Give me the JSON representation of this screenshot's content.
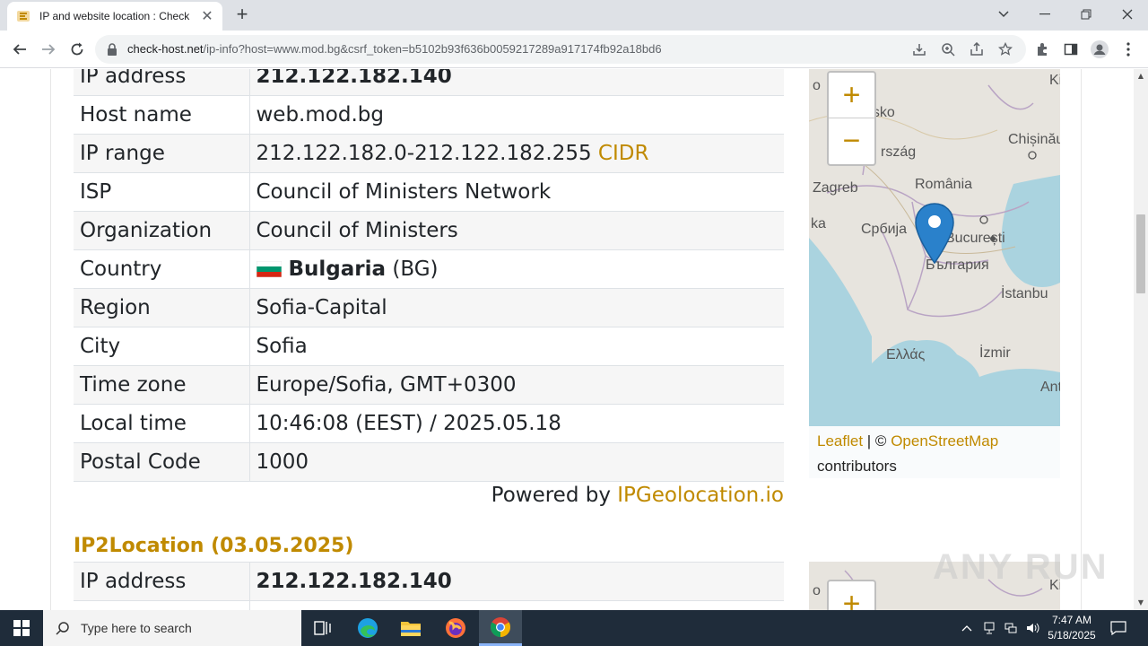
{
  "browser": {
    "tab_title": "IP and website location : Check h",
    "url_host": "check-host.net",
    "url_path": "/ip-info?host=www.mod.bg&csrf_token=b5102b93f636b0059217289a917174fb92a18bd6"
  },
  "info_table": {
    "rows": [
      {
        "label": "IP address",
        "value": "212.122.182.140"
      },
      {
        "label": "Host name",
        "value": "web.mod.bg"
      },
      {
        "label": "IP range",
        "value": "212.122.182.0-212.122.182.255",
        "link": "CIDR"
      },
      {
        "label": "ISP",
        "value": "Council of Ministers Network"
      },
      {
        "label": "Organization",
        "value": "Council of Ministers"
      },
      {
        "label": "Country",
        "value": "Bulgaria",
        "suffix": "(BG)"
      },
      {
        "label": "Region",
        "value": "Sofia-Capital"
      },
      {
        "label": "City",
        "value": "Sofia"
      },
      {
        "label": "Time zone",
        "value": "Europe/Sofia, GMT+0300"
      },
      {
        "label": "Local time",
        "value": "10:46:08 (EEST) / 2025.05.18"
      },
      {
        "label": "Postal Code",
        "value": "1000"
      }
    ]
  },
  "powered": {
    "prefix": "Powered by",
    "link": "IPGeolocation.io"
  },
  "section2": {
    "title": "IP2Location (03.05.2025)",
    "rows": [
      {
        "label": "IP address",
        "value": "212.122.182.140"
      }
    ]
  },
  "map": {
    "zoom_in": "+",
    "zoom_out": "−",
    "attribution_leaflet": "Leaflet",
    "attribution_sep": "| ©",
    "attribution_osm": "OpenStreetMap",
    "attribution_tail": "contributors",
    "labels": {
      "ki": "Ki",
      "o1": "o",
      "nsko": "nsko",
      "chisinau": "Chișinău",
      "orszag": "rszág",
      "zagreb": "Zagreb",
      "romania": "România",
      "ka": "ka",
      "srbija": "Србија",
      "bucuresti": "București",
      "bulgaria": "България",
      "istanbul": "İstanbu",
      "ellas": "Ελλάς",
      "izmir": "İzmir",
      "ant": "Ant",
      "o2": "o",
      "ki2": "Ki"
    }
  },
  "watermark": "ANY RUN",
  "taskbar": {
    "search_placeholder": "Type here to search",
    "time": "7:47 AM",
    "date": "5/18/2025"
  }
}
